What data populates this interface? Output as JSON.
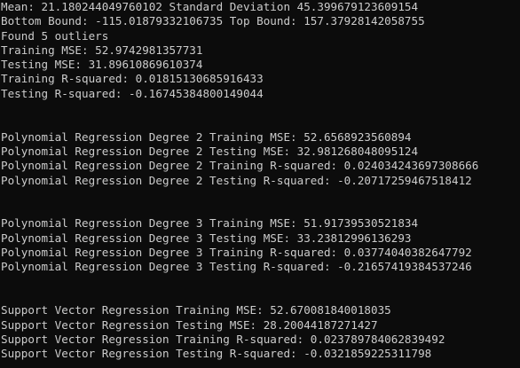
{
  "theme": {
    "background": "#0c0c0c",
    "foreground": "#cccccc"
  },
  "console": {
    "lines": [
      "Mean: 21.180244049760102 Standard Deviation 45.399679123609154",
      "Bottom Bound: -115.01879332106735 Top Bound: 157.37928142058755",
      "Found 5 outliers",
      "Training MSE: 52.9742981357731",
      "Testing MSE: 31.89610869610374",
      "Training R-squared: 0.01815130685916433",
      "Testing R-squared: -0.16745384800149044",
      "",
      "",
      "Polynomial Regression Degree 2 Training MSE: 52.6568923560894",
      "Polynomial Regression Degree 2 Testing MSE: 32.981268048095124",
      "Polynomial Regression Degree 2 Training R-squared: 0.024034243697308666",
      "Polynomial Regression Degree 2 Testing R-squared: -0.20717259467518412",
      "",
      "",
      "Polynomial Regression Degree 3 Training MSE: 51.91739530521834",
      "Polynomial Regression Degree 3 Testing MSE: 33.23812996136293",
      "Polynomial Regression Degree 3 Training R-squared: 0.03774040382647792",
      "Polynomial Regression Degree 3 Testing R-squared: -0.21657419384537246",
      "",
      "",
      "Support Vector Regression Training MSE: 52.670081840018035",
      "Support Vector Regression Testing MSE: 28.20044187271427",
      "Support Vector Regression Training R-squared: 0.023789784062839492",
      "Support Vector Regression Testing R-squared: -0.0321859225311798"
    ]
  }
}
